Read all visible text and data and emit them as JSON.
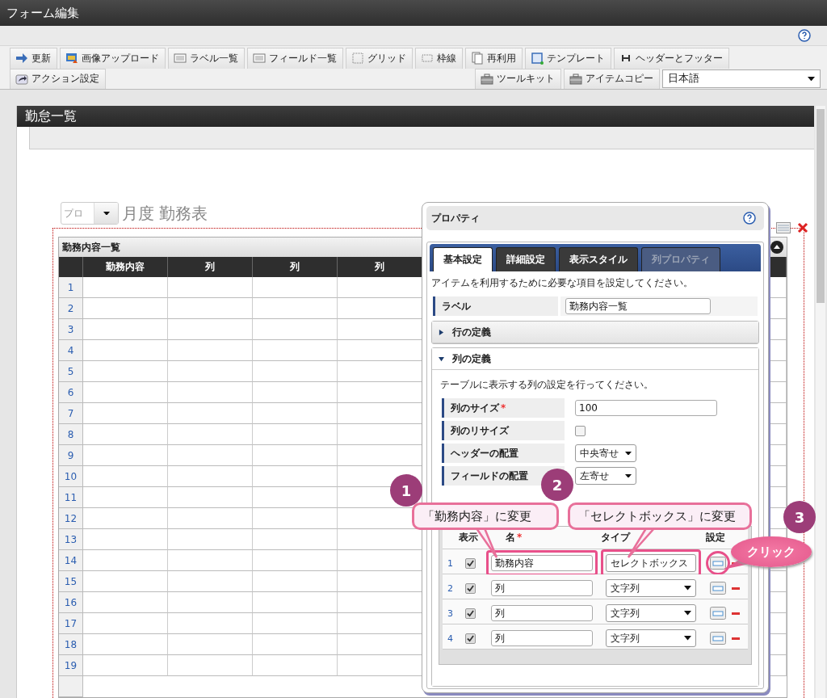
{
  "window": {
    "title": "フォーム編集"
  },
  "toolbar": {
    "row1": [
      "更新",
      "画像アップロード",
      "ラベル一覧",
      "フィールド一覧",
      "グリッド",
      "枠線",
      "再利用",
      "テンプレート",
      "ヘッダーとフッター"
    ],
    "row2_left": [
      "アクション設定"
    ],
    "row2_right": [
      "ツールキット",
      "アイテムコピー"
    ],
    "language": "日本語"
  },
  "form": {
    "title": "勤怠一覧",
    "month_select": "プロ",
    "heading": "月度 勤務表",
    "table": {
      "title": "勤務内容一覧",
      "columns": [
        "勤務内容",
        "列",
        "列",
        "列"
      ],
      "rows": [
        "1",
        "2",
        "3",
        "4",
        "5",
        "6",
        "7",
        "8",
        "9",
        "10",
        "11",
        "12",
        "13",
        "14",
        "15",
        "16",
        "17",
        "18",
        "19"
      ]
    }
  },
  "dialog": {
    "title": "プロパティ",
    "tabs": [
      {
        "label": "基本設定",
        "selected": true,
        "disabled": false
      },
      {
        "label": "詳細設定",
        "selected": false,
        "disabled": false
      },
      {
        "label": "表示スタイル",
        "selected": false,
        "disabled": false
      },
      {
        "label": "列プロパティ",
        "selected": false,
        "disabled": true
      }
    ],
    "description": "アイテムを利用するために必要な項目を設定してください。",
    "label_field": {
      "label": "ラベル",
      "value": "勤務内容一覧"
    },
    "sections": [
      {
        "title": "行の定義",
        "expanded": false
      },
      {
        "title": "列の定義",
        "expanded": true
      }
    ],
    "column_def": {
      "description": "テーブルに表示する列の設定を行ってください。",
      "properties": [
        {
          "kind": "text",
          "label": "列のサイズ",
          "required_mark": "*",
          "value": "100"
        },
        {
          "kind": "checkbox",
          "label": "列のリサイズ",
          "checked": false
        },
        {
          "kind": "select",
          "label": "ヘッダーの配置",
          "value": "中央寄せ"
        },
        {
          "kind": "select",
          "label": "フィールドの配置",
          "value": "左寄せ"
        }
      ],
      "headers": [
        {
          "label": "表示"
        },
        {
          "label": "名",
          "required_mark": "*"
        },
        {
          "label": "タイプ"
        },
        {
          "label": "設定"
        }
      ],
      "rows": [
        {
          "num": "1",
          "shown": true,
          "name": "勤務内容",
          "type": "セレクトボックス",
          "highlighted": true
        },
        {
          "num": "2",
          "shown": true,
          "name": "列",
          "type": "文字列",
          "highlighted": false
        },
        {
          "num": "3",
          "shown": true,
          "name": "列",
          "type": "文字列",
          "highlighted": false
        },
        {
          "num": "4",
          "shown": true,
          "name": "列",
          "type": "文字列",
          "highlighted": false
        }
      ]
    }
  },
  "annotations": [
    {
      "number": "1",
      "text": "「勤務内容」に変更"
    },
    {
      "number": "2",
      "text": "「セレクトボックス」に変更"
    },
    {
      "number": "3",
      "text": "クリック"
    }
  ]
}
